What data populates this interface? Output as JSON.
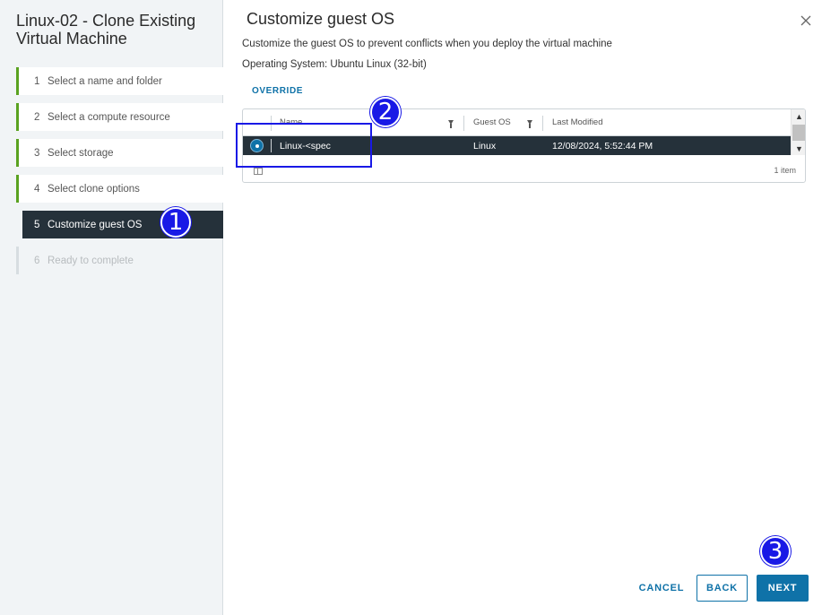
{
  "wizard": {
    "title": "Linux-02 - Clone Existing Virtual Machine",
    "steps": [
      {
        "num": "1",
        "label": "Select a name and folder",
        "state": "completed"
      },
      {
        "num": "2",
        "label": "Select a compute resource",
        "state": "completed"
      },
      {
        "num": "3",
        "label": "Select storage",
        "state": "completed"
      },
      {
        "num": "4",
        "label": "Select clone options",
        "state": "completed"
      },
      {
        "num": "5",
        "label": "Customize guest OS",
        "state": "active"
      },
      {
        "num": "6",
        "label": "Ready to complete",
        "state": "disabled"
      }
    ]
  },
  "page": {
    "title": "Customize guest OS",
    "description": "Customize the guest OS to prevent conflicts when you deploy the virtual machine",
    "os_line": "Operating System: Ubuntu Linux (32-bit)",
    "override_label": "OVERRIDE"
  },
  "grid": {
    "columns": [
      "Name",
      "Guest OS",
      "Last Modified"
    ],
    "rows": [
      {
        "name": "Linux-<spec",
        "guest_os": "Linux",
        "last_modified": "12/08/2024, 5:52:44 PM",
        "selected": true
      }
    ],
    "footer_count": "1 item"
  },
  "buttons": {
    "cancel": "CANCEL",
    "back": "BACK",
    "next": "NEXT"
  },
  "annotations": {
    "marker_1": "1",
    "marker_2": "2",
    "marker_3": "3",
    "color": "#1919e6"
  },
  "colors": {
    "accent": "#0f72a8",
    "completed_step": "#5aa220",
    "active_step_bg": "#25313a",
    "sidebar_bg": "#f1f4f6"
  }
}
